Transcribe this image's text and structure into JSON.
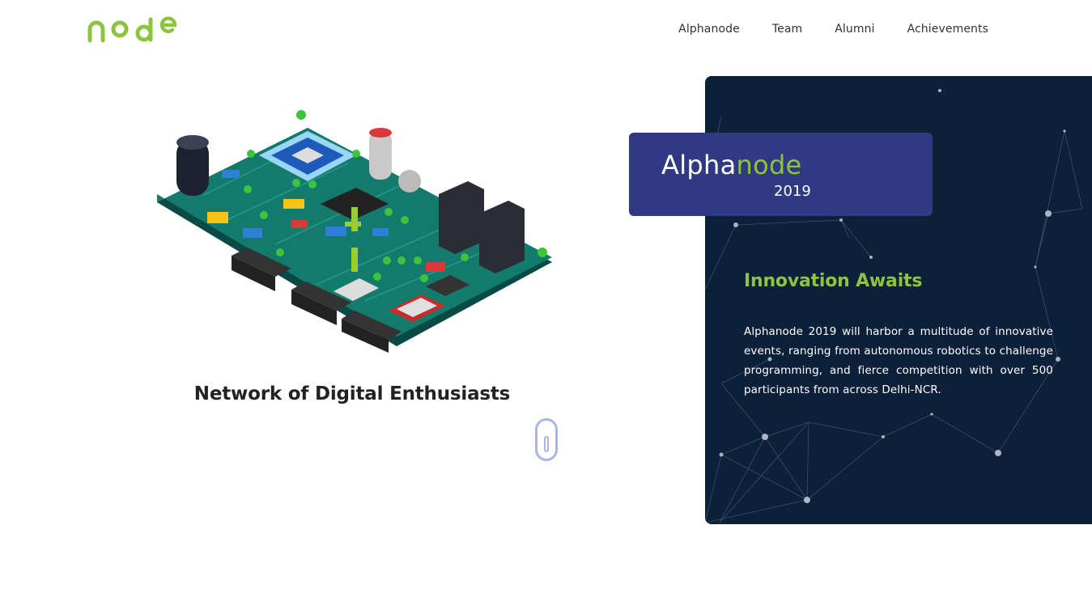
{
  "header": {
    "logo_text": "node",
    "nav": [
      {
        "label": "Alphanode"
      },
      {
        "label": "Team"
      },
      {
        "label": "Alumni"
      },
      {
        "label": "Achievements"
      }
    ]
  },
  "hero": {
    "tagline": "Network of Digital Enthusiasts",
    "illustration": "circuit-board-icon"
  },
  "card": {
    "brand_prefix": "Alpha",
    "brand_accent": "node",
    "year": "2019",
    "title": "Innovation Awaits",
    "text": "Alphanode 2019 will harbor a multitude of innovative events, ranging from autonomous robotics to challenge programming, and fierce competition with over 500 participants from across Delhi-NCR."
  },
  "colors": {
    "accent_green": "#8dc43f",
    "badge_blue": "#2f3a82",
    "card_navy": "#0d2039",
    "scroll_indicator": "#aab4e8"
  }
}
